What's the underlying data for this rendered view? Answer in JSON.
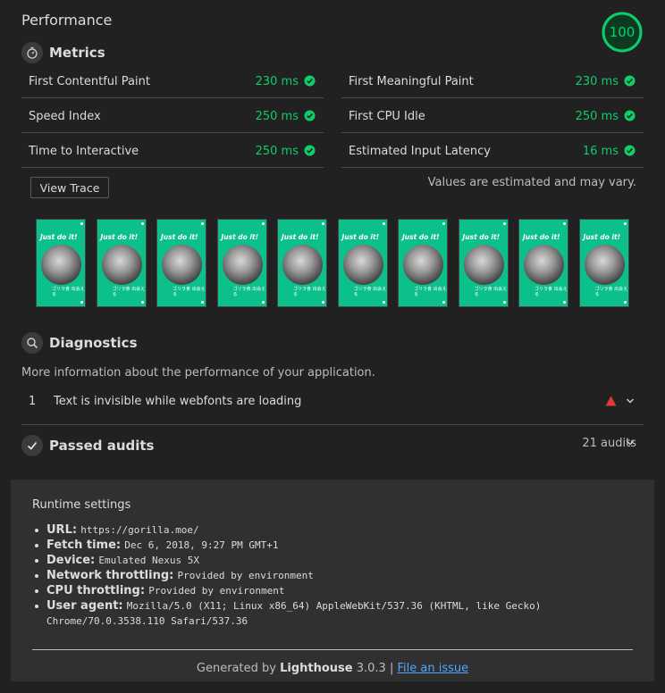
{
  "header": {
    "title": "Performance",
    "score": "100"
  },
  "metrics": {
    "title": "Metrics",
    "left": [
      {
        "label": "First Contentful Paint",
        "value": "230 ms"
      },
      {
        "label": "Speed Index",
        "value": "250 ms"
      },
      {
        "label": "Time to Interactive",
        "value": "250 ms"
      }
    ],
    "right": [
      {
        "label": "First Meaningful Paint",
        "value": "230 ms"
      },
      {
        "label": "First CPU Idle",
        "value": "250 ms"
      },
      {
        "label": "Estimated Input Latency",
        "value": "16 ms"
      }
    ],
    "view_trace_label": "View Trace",
    "estimate_note": "Values are estimated and may vary."
  },
  "filmstrip": {
    "frame_title": "Just do it!",
    "frame_caption": "ゴリラ食 出会える",
    "frame_count": 10
  },
  "diagnostics": {
    "title": "Diagnostics",
    "description": "More information about the performance of your application.",
    "items": [
      {
        "number": "1",
        "text": "Text is invisible while webfonts are loading"
      }
    ]
  },
  "passed": {
    "title": "Passed audits",
    "count": "21 audits"
  },
  "runtime": {
    "title": "Runtime settings",
    "settings": [
      {
        "key": "URL:",
        "value": "https://gorilla.moe/"
      },
      {
        "key": "Fetch time:",
        "value": "Dec 6, 2018, 9:27 PM GMT+1"
      },
      {
        "key": "Device:",
        "value": "Emulated Nexus 5X"
      },
      {
        "key": "Network throttling:",
        "value": "Provided by environment"
      },
      {
        "key": "CPU throttling:",
        "value": "Provided by environment"
      },
      {
        "key": "User agent:",
        "value": "Mozilla/5.0 (X11; Linux x86_64) AppleWebKit/537.36 (KHTML, like Gecko) Chrome/70.0.3538.110 Safari/537.36"
      }
    ]
  },
  "footer": {
    "generated_by": "Generated by",
    "tool": "Lighthouse",
    "version": "3.0.3",
    "separator": "|",
    "issue_link": "File an issue"
  },
  "colors": {
    "pass": "#0cce6b",
    "fail": "#e53935",
    "link": "#4ea6ff",
    "background": "#212121"
  },
  "icons": {
    "metrics": "stopwatch-icon",
    "diagnostics": "search-icon",
    "passed": "checkmark-icon",
    "metric_status": "check-circle-icon",
    "warning": "warning-triangle-icon",
    "expand": "chevron-down-icon"
  }
}
